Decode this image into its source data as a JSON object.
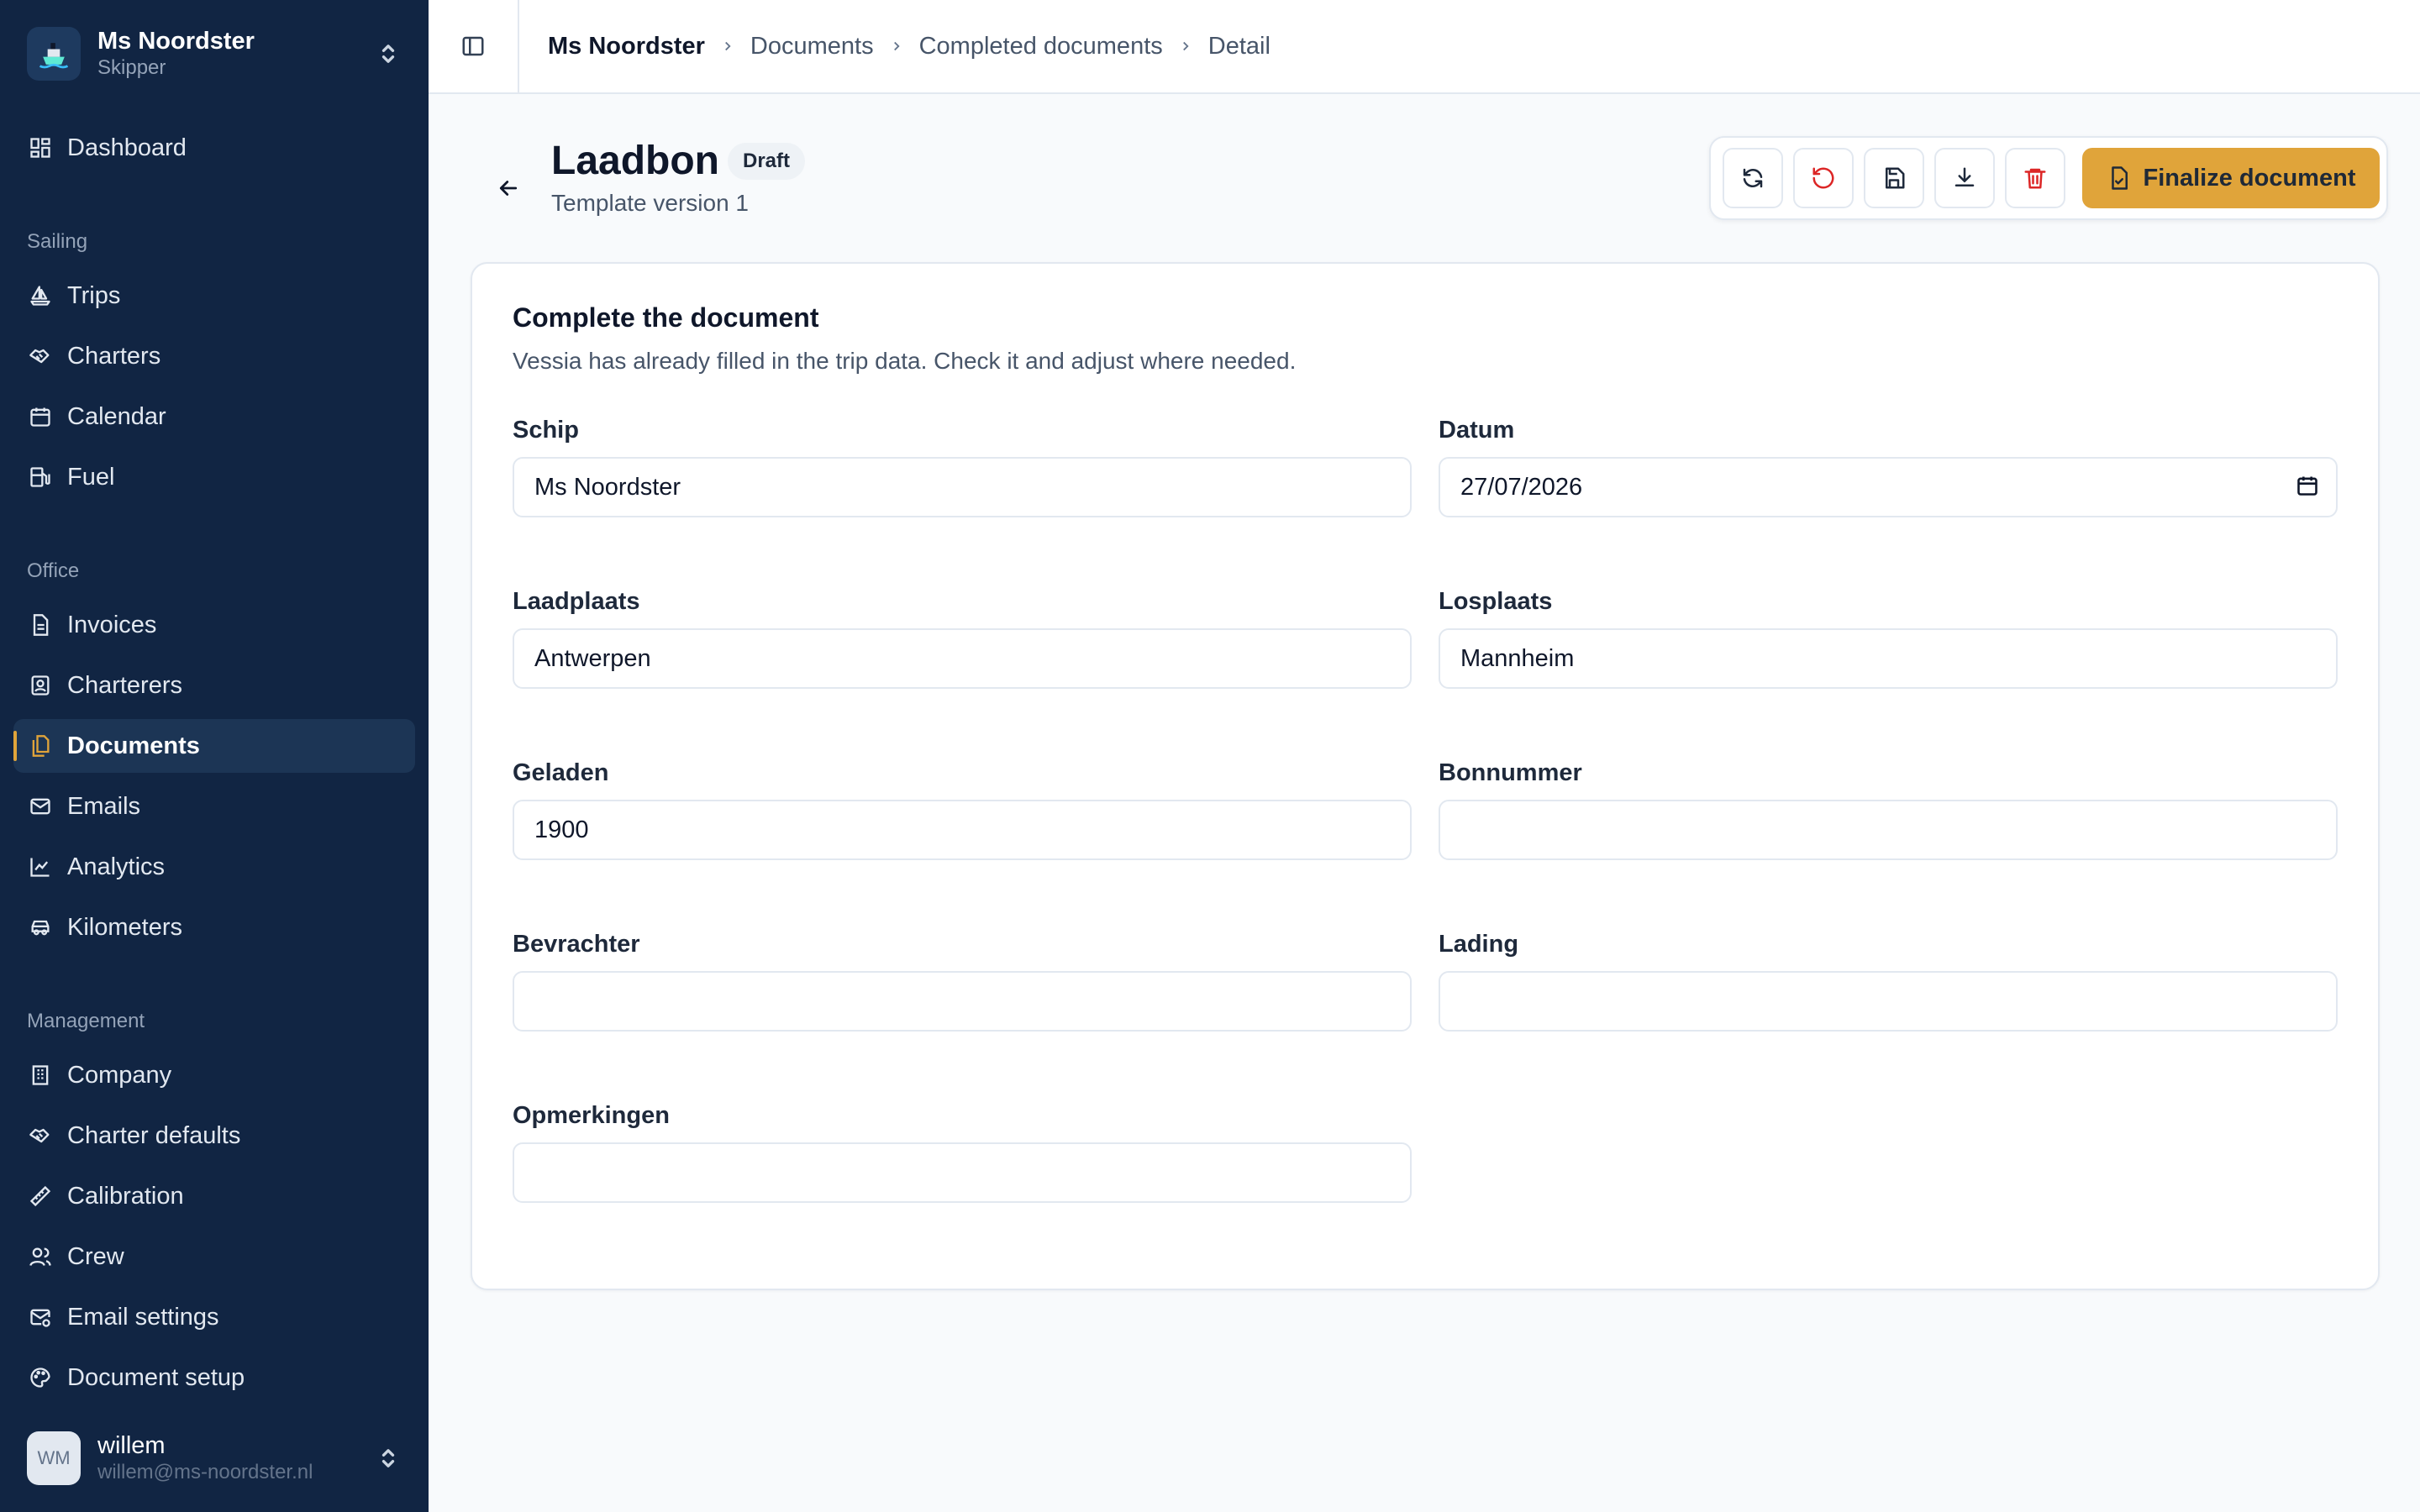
{
  "brand": {
    "name": "Ms Noordster",
    "role": "Skipper"
  },
  "nav": {
    "dashboard": "Dashboard",
    "sections": {
      "sailing": "Sailing",
      "office": "Office",
      "management": "Management"
    },
    "sailing": [
      "Trips",
      "Charters",
      "Calendar",
      "Fuel"
    ],
    "office": [
      "Invoices",
      "Charterers",
      "Documents",
      "Emails",
      "Analytics",
      "Kilometers"
    ],
    "management": [
      "Company",
      "Charter defaults",
      "Calibration",
      "Crew",
      "Email settings",
      "Document setup"
    ],
    "active": "Documents"
  },
  "user": {
    "initials": "WM",
    "name": "willem",
    "email": "willem@ms-noordster.nl"
  },
  "breadcrumbs": [
    "Ms Noordster",
    "Documents",
    "Completed documents",
    "Detail"
  ],
  "doc": {
    "title": "Laadbon",
    "status": "Draft",
    "subtitle": "Template version 1"
  },
  "toolbar": {
    "finalize_label": "Finalize document"
  },
  "card": {
    "title": "Complete the document",
    "description": "Vessia has already filled in the trip data. Check it and adjust where needed."
  },
  "fields": {
    "schip": {
      "label": "Schip",
      "value": "Ms Noordster"
    },
    "datum": {
      "label": "Datum",
      "value": "27/07/2026"
    },
    "laadplaats": {
      "label": "Laadplaats",
      "value": "Antwerpen"
    },
    "losplaats": {
      "label": "Losplaats",
      "value": "Mannheim"
    },
    "geladen": {
      "label": "Geladen",
      "value": "1900"
    },
    "bonnummer": {
      "label": "Bonnummer",
      "value": ""
    },
    "bevrachter": {
      "label": "Bevrachter",
      "value": ""
    },
    "lading": {
      "label": "Lading",
      "value": ""
    },
    "opmerkingen": {
      "label": "Opmerkingen",
      "value": ""
    }
  },
  "colors": {
    "sidebar": "#112543",
    "accent": "#e0a43a",
    "danger": "#dc2626"
  }
}
